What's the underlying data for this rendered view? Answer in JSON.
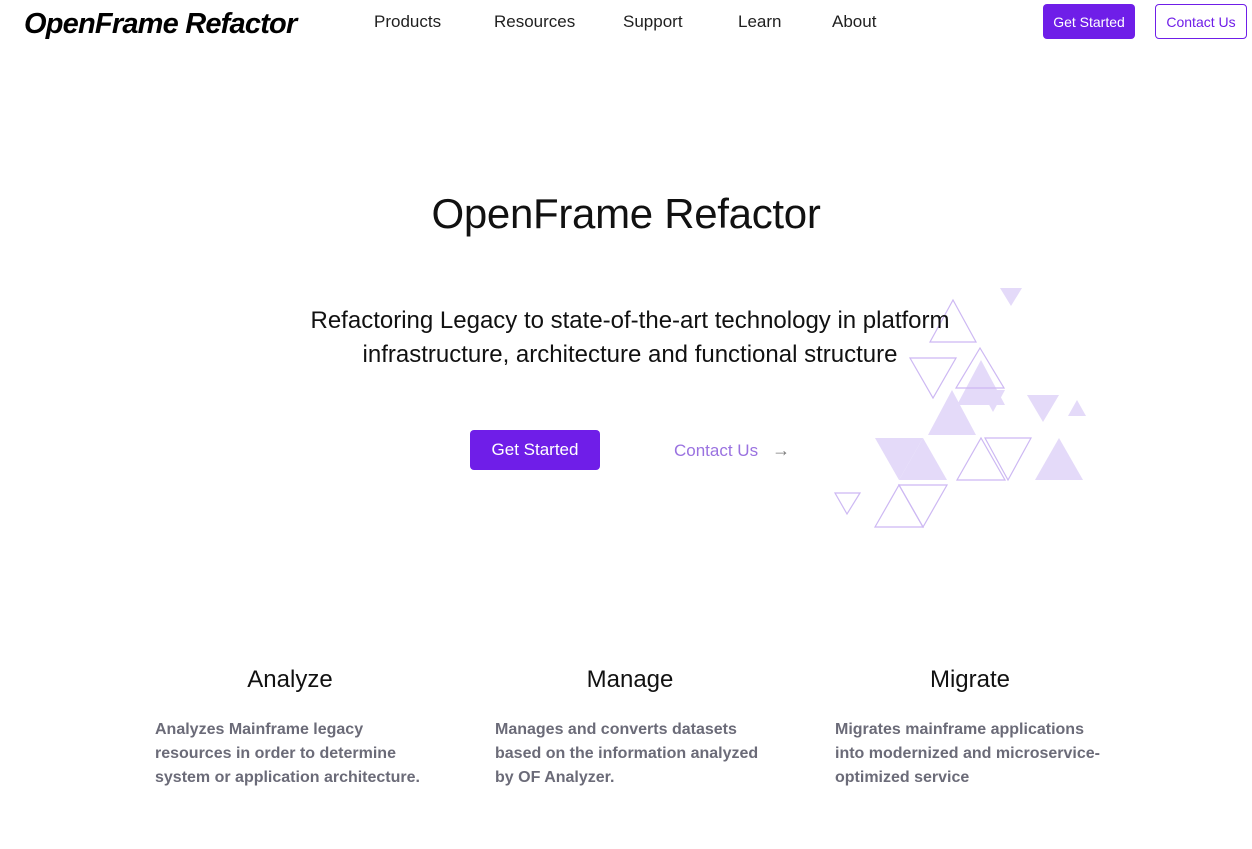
{
  "header": {
    "logo": "OpenFrame Refactor",
    "nav": [
      "Products",
      "Resources",
      "Support",
      "Learn",
      "About"
    ],
    "get_started": "Get Started",
    "contact_us": "Contact Us"
  },
  "hero": {
    "title": "OpenFrame Refactor",
    "subtitle_line1": "Refactoring Legacy to state-of-the-art technology in platform",
    "subtitle_line2": "infrastructure, architecture and functional structure",
    "get_started": "Get Started",
    "contact_us": "Contact Us",
    "contact_arrow_icon": "arrow-right-icon"
  },
  "features": [
    {
      "title": "Analyze",
      "description": "Analyzes Mainframe legacy resources in order to determine system or application architecture."
    },
    {
      "title": "Manage",
      "description": "Manages and converts datasets based on the information analyzed by OF Analyzer."
    },
    {
      "title": "Migrate",
      "description": "Migrates mainframe applications into modernized and microservice-optimized service"
    }
  ],
  "colors": {
    "accent": "#6f1ee8",
    "link": "#9a72e0",
    "muted_text": "#6b6b78",
    "decoration": "#c8b5f0"
  }
}
